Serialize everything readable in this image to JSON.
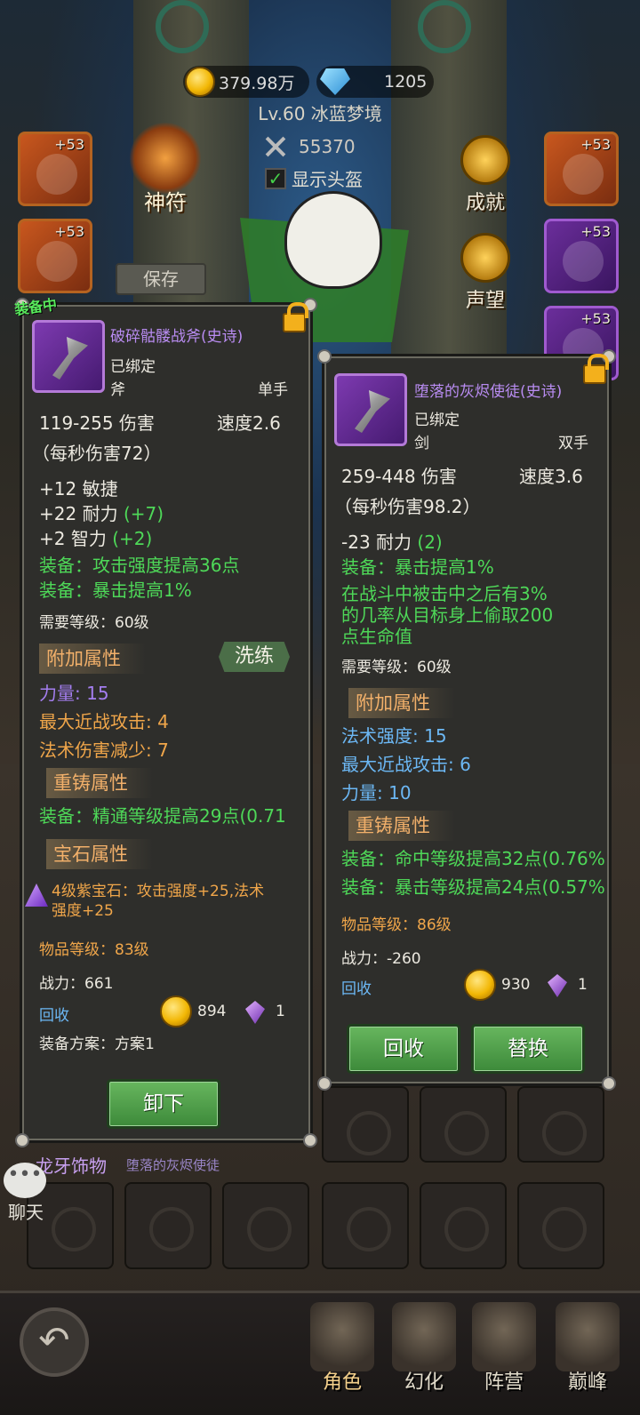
{
  "top": {
    "gold": "379.98万",
    "gems": "1205",
    "level_title": "Lv.60 冰蓝梦境",
    "combat_power": "55370",
    "show_helmet_label": "显示头盔",
    "show_helmet_checked": true,
    "rune_label": "神符",
    "achievements_label": "成就",
    "reputation_label": "声望",
    "save_label": "保存",
    "slots": [
      {
        "name": "left-slot-1",
        "plus": "+53"
      },
      {
        "name": "left-slot-2",
        "plus": "+53"
      },
      {
        "name": "right-slot-1",
        "plus": "+53"
      },
      {
        "name": "right-slot-2",
        "plus": "+53"
      },
      {
        "name": "right-slot-3",
        "plus": "+53"
      }
    ]
  },
  "equipped": {
    "tag": "装备中",
    "name": "破碎骷髅战斧(史诗)",
    "bound": "已绑定",
    "type": "斧",
    "hand": "单手",
    "damage": "119-255 伤害",
    "speed": "速度2.6",
    "dps": "（每秒伤害72）",
    "stats": [
      {
        "text": "+12 敏捷",
        "bonus": ""
      },
      {
        "text": "+22 耐力",
        "bonus": "(+7)"
      },
      {
        "text": "+2 智力",
        "bonus": "(+2)"
      }
    ],
    "effects": [
      "装备：攻击强度提高36点",
      "装备：暴击提高1%"
    ],
    "required_level": "需要等级：60级",
    "extra_title": "附加属性",
    "refine_label": "洗练",
    "extra": [
      {
        "label": "力量:",
        "value": "15"
      },
      {
        "label": "最大近战攻击:",
        "value": "4"
      },
      {
        "label": "法术伤害减少:",
        "value": "7"
      }
    ],
    "reforge_title": "重铸属性",
    "reforge": [
      "装备：精通等级提高29点(0.71"
    ],
    "gem_title": "宝石属性",
    "gem_text_1": "4级紫宝石：攻击强度+25,法术",
    "gem_text_2": "强度+25",
    "item_level": "物品等级：83级",
    "power": "战力：661",
    "recycle_label": "回收",
    "recycle_gold": "894",
    "recycle_gems": "1",
    "plan": "装备方案：方案1",
    "unequip_label": "卸下"
  },
  "candidate": {
    "name": "堕落的灰烬使徒(史诗)",
    "bound": "已绑定",
    "type": "剑",
    "hand": "双手",
    "damage": "259-448 伤害",
    "speed": "速度3.6",
    "dps": "（每秒伤害98.2）",
    "stats": [
      {
        "text": "-23 耐力",
        "bonus": "(2)"
      }
    ],
    "effects": [
      "装备：暴击提高1%"
    ],
    "proc_text": [
      "在战斗中被击中之后有3%",
      "的几率从目标身上偷取200",
      "点生命值"
    ],
    "required_level": "需要等级：60级",
    "extra_title": "附加属性",
    "extra": [
      {
        "label": "法术强度:",
        "value": "15"
      },
      {
        "label": "最大近战攻击:",
        "value": "6"
      },
      {
        "label": "力量:",
        "value": "10"
      }
    ],
    "reforge_title": "重铸属性",
    "reforge": [
      "装备：命中等级提高32点(0.76%",
      "装备：暴击等级提高24点(0.57%"
    ],
    "item_level": "物品等级：86级",
    "power": "战力：-260",
    "recycle_label": "回收",
    "recycle_gold": "930",
    "recycle_gems": "1",
    "recycle_button": "回收",
    "replace_button": "替换"
  },
  "lower": {
    "group_title": "龙牙饰物",
    "group_sub": "堕落的灰烬使徒",
    "chat_label": "聊天"
  },
  "nav": {
    "items": [
      {
        "label": "角色",
        "active": true
      },
      {
        "label": "幻化",
        "active": false
      },
      {
        "label": "阵营",
        "active": false
      },
      {
        "label": "巅峰",
        "active": false
      }
    ]
  }
}
